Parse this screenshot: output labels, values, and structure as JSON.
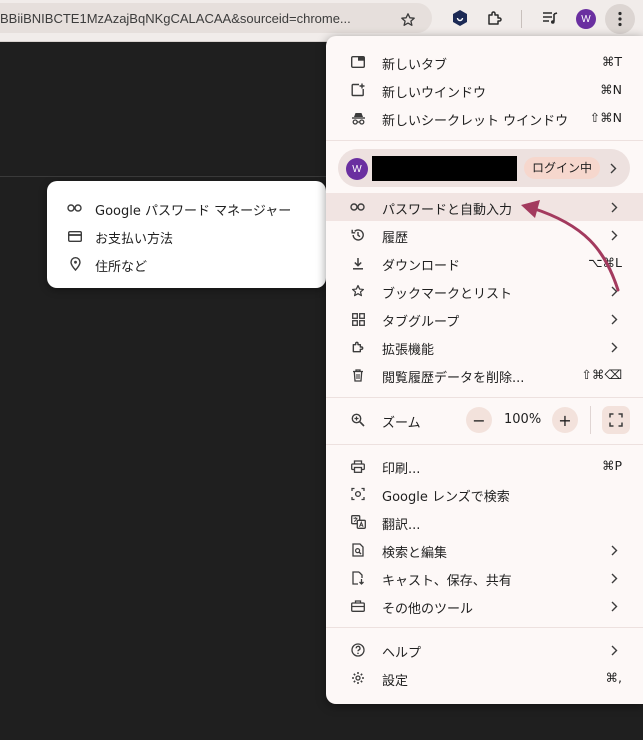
{
  "toolbar": {
    "url_text": "BBiiBNIBCTE1MzAzajBqNKgCALACAA&sourceid=chrome...",
    "avatar_letter": "W"
  },
  "submenu": {
    "items": [
      {
        "label": "Google パスワード マネージャー",
        "icon": "key-icon"
      },
      {
        "label": "お支払い方法",
        "icon": "credit-card-icon"
      },
      {
        "label": "住所など",
        "icon": "location-pin-icon"
      }
    ]
  },
  "menu": {
    "new_tab": {
      "label": "新しいタブ",
      "shortcut": "⌘T"
    },
    "new_window": {
      "label": "新しいウインドウ",
      "shortcut": "⌘N"
    },
    "new_incognito": {
      "label": "新しいシークレット ウインドウ",
      "shortcut": "⇧⌘N"
    },
    "profile": {
      "avatar_letter": "W",
      "signin_label": "ログイン中"
    },
    "passwords": {
      "label": "パスワードと自動入力"
    },
    "history": {
      "label": "履歴"
    },
    "downloads": {
      "label": "ダウンロード",
      "shortcut": "⌥⌘L"
    },
    "bookmarks": {
      "label": "ブックマークとリスト"
    },
    "tab_groups": {
      "label": "タブグループ"
    },
    "extensions": {
      "label": "拡張機能"
    },
    "clear_data": {
      "label": "閲覧履歴データを削除...",
      "shortcut": "⇧⌘⌫"
    },
    "zoom": {
      "label": "ズーム",
      "value": "100%",
      "minus": "−",
      "plus": "+"
    },
    "print": {
      "label": "印刷...",
      "shortcut": "⌘P"
    },
    "lens": {
      "label": "Google レンズで検索"
    },
    "translate": {
      "label": "翻訳..."
    },
    "find_edit": {
      "label": "検索と編集"
    },
    "cast_save": {
      "label": "キャスト、保存、共有"
    },
    "more_tools": {
      "label": "その他のツール"
    },
    "help": {
      "label": "ヘルプ"
    },
    "settings": {
      "label": "設定",
      "shortcut": "⌘,"
    }
  },
  "colors": {
    "menu_bg": "#fdf8f7",
    "highlight": "#f1e4e2",
    "avatar": "#6a2fa0",
    "annotation_arrow": "#a33a5e"
  }
}
